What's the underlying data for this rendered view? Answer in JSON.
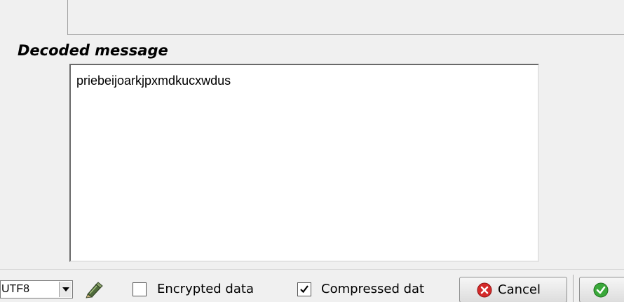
{
  "decoded_section": {
    "title": "Decoded message",
    "message": "priebeijoarkjpxmdkucxwdus"
  },
  "bottom_bar": {
    "encoding": {
      "selected": "UTF8"
    },
    "edit_icon": "pen-icon",
    "encrypted": {
      "label": "Encrypted data",
      "checked": false
    },
    "compressed": {
      "label": "Compressed dat",
      "checked": true
    },
    "cancel_button": {
      "label": "Cancel",
      "icon": "cancel-icon",
      "icon_color": "#d42a2a"
    },
    "ok_button": {
      "label": "",
      "icon": "ok-icon",
      "icon_color": "#3aa83a"
    }
  }
}
